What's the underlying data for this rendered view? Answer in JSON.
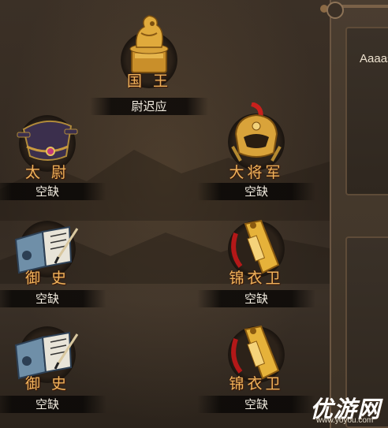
{
  "king": {
    "title": "国 王",
    "holder": "尉迟应",
    "icon": "golden-seal-icon"
  },
  "left_slots": [
    {
      "title": "太 尉",
      "holder": "空缺",
      "icon": "official-hat-icon"
    },
    {
      "title": "御 史",
      "holder": "空缺",
      "icon": "scroll-book-icon"
    },
    {
      "title": "御 史",
      "holder": "空缺",
      "icon": "scroll-book-icon"
    }
  ],
  "right_slots": [
    {
      "title": "大将军",
      "holder": "空缺",
      "icon": "general-helmet-icon"
    },
    {
      "title": "锦衣卫",
      "holder": "空缺",
      "icon": "golden-token-icon"
    },
    {
      "title": "锦衣卫",
      "holder": "空缺",
      "icon": "golden-token-icon"
    }
  ],
  "side_panel": {
    "text": "Aaaas"
  },
  "watermark": {
    "text": "优游网",
    "url": "www.yoyou.com"
  },
  "colors": {
    "title": "#f0b35c",
    "holder_text": "#f2ece0",
    "background": "#342a21",
    "panel_border": "#6b5642"
  }
}
